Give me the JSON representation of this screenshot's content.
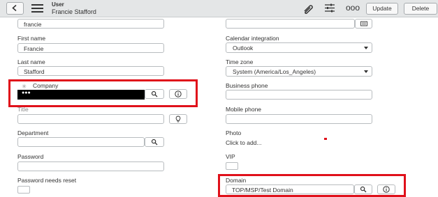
{
  "header": {
    "record_type": "User",
    "record_name": "Francie Stafford",
    "more_label": "ooo",
    "update_label": "Update",
    "delete_label": "Delete"
  },
  "form": {
    "user_id": {
      "value": "francie"
    },
    "first_name": {
      "label": "First name",
      "value": "Francie"
    },
    "last_name": {
      "label": "Last name",
      "value": "Stafford"
    },
    "company": {
      "mandatory_mark": "✳",
      "label": "Company",
      "value": "●●●"
    },
    "title": {
      "label": "Title",
      "value": ""
    },
    "department": {
      "label": "Department",
      "value": ""
    },
    "password": {
      "label": "Password",
      "value": ""
    },
    "password_needs_reset": {
      "label": "Password needs reset",
      "checked": false
    },
    "email": {
      "value": ""
    },
    "calendar_integration": {
      "label": "Calendar integration",
      "value": "Outlook"
    },
    "time_zone": {
      "label": "Time zone",
      "value": "System (America/Los_Angeles)"
    },
    "business_phone": {
      "label": "Business phone",
      "value": ""
    },
    "mobile_phone": {
      "label": "Mobile phone",
      "value": ""
    },
    "photo": {
      "label": "Photo",
      "link": "Click to add..."
    },
    "vip": {
      "label": "VIP",
      "checked": false
    },
    "domain": {
      "label": "Domain",
      "value": "TOP/MSP/Test Domain"
    }
  },
  "colors": {
    "highlight": "#e0101a",
    "header_bg": "#e4e6e7"
  }
}
